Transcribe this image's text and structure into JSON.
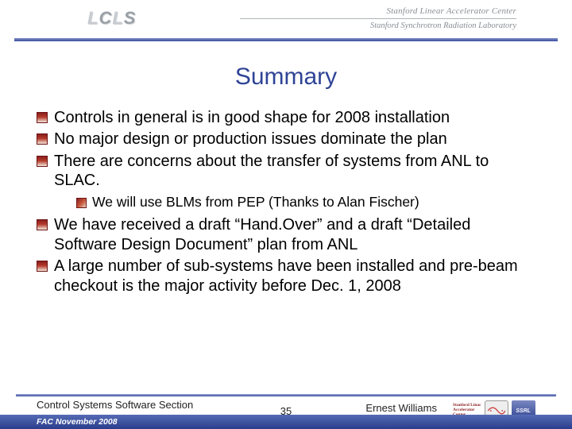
{
  "header": {
    "logo_text": "LCLS",
    "org_top": "Stanford Linear Accelerator Center",
    "org_bottom": "Stanford Synchrotron Radiation Laboratory"
  },
  "title": "Summary",
  "bullets": [
    {
      "text": "Controls in general is in good shape for 2008 installation"
    },
    {
      "text": "No major design or production issues dominate the plan"
    },
    {
      "text": "There are concerns about the transfer of systems from ANL to SLAC.",
      "sub": [
        {
          "text": "We will use BLMs from PEP (Thanks to Alan Fischer)"
        }
      ]
    },
    {
      "text": "We have received a draft “Hand.Over” and a draft “Detailed Software Design Document” plan from ANL"
    },
    {
      "text": "A large number of sub-systems have been installed and pre-beam checkout is the major activity before Dec. 1, 2008"
    }
  ],
  "footer": {
    "section": "Control Systems Software Section",
    "date": "FAC November 2008",
    "page": "35",
    "author": "Ernest Williams",
    "mini_org_lines": [
      "Stanford Linac",
      "Accelerator",
      "Center"
    ],
    "mini_badge": "SSRL"
  }
}
